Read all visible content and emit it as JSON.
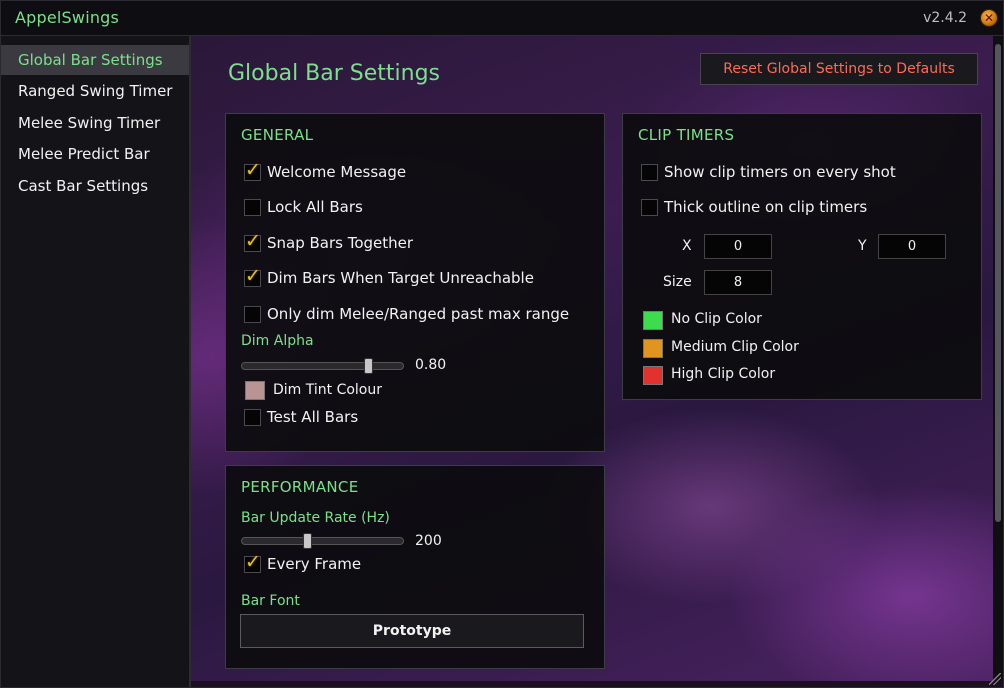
{
  "app": {
    "title": "AppelSwings",
    "version": "v2.4.2",
    "close_glyph": "✕"
  },
  "sidebar": {
    "items": [
      {
        "label": "Global Bar Settings",
        "active": true
      },
      {
        "label": "Ranged Swing Timer",
        "active": false
      },
      {
        "label": "Melee Swing Timer",
        "active": false
      },
      {
        "label": "Melee Predict Bar",
        "active": false
      },
      {
        "label": "Cast Bar Settings",
        "active": false
      }
    ]
  },
  "main": {
    "title": "Global Bar Settings",
    "reset_label": "Reset Global Settings to Defaults"
  },
  "general": {
    "title": "GENERAL",
    "checkboxes": [
      {
        "label": "Welcome Message",
        "checked": true
      },
      {
        "label": "Lock All Bars",
        "checked": false
      },
      {
        "label": "Snap Bars Together",
        "checked": true
      },
      {
        "label": "Dim Bars When Target Unreachable",
        "checked": true
      },
      {
        "label": "Only dim Melee/Ranged past max range",
        "checked": false
      }
    ],
    "dim_alpha_label": "Dim Alpha",
    "dim_alpha_value": "0.80",
    "dim_alpha_fraction": 0.8,
    "dim_tint_label": "Dim Tint Colour",
    "dim_tint_color": "#b99494",
    "test_all_label": "Test All Bars",
    "test_all_checked": false
  },
  "performance": {
    "title": "PERFORMANCE",
    "rate_label": "Bar Update Rate (Hz)",
    "rate_value": "200",
    "rate_fraction": 0.4,
    "every_frame_label": "Every Frame",
    "every_frame_checked": true,
    "font_label": "Bar Font",
    "font_value": "Prototype"
  },
  "clip": {
    "title": "CLIP TIMERS",
    "show_every_shot_label": "Show clip timers on every shot",
    "show_every_shot_checked": false,
    "thick_outline_label": "Thick outline on clip timers",
    "thick_outline_checked": false,
    "x_label": "X",
    "x_value": "0",
    "y_label": "Y",
    "y_value": "0",
    "size_label": "Size",
    "size_value": "8",
    "colors": [
      {
        "label": "No Clip Color",
        "color": "#3ddc4e"
      },
      {
        "label": "Medium Clip Color",
        "color": "#e0951e"
      },
      {
        "label": "High Clip Color",
        "color": "#e2322e"
      }
    ]
  },
  "theme": {
    "accent": "#7be08a",
    "warning": "#ff6a55",
    "checkmark": "#e8c020"
  }
}
